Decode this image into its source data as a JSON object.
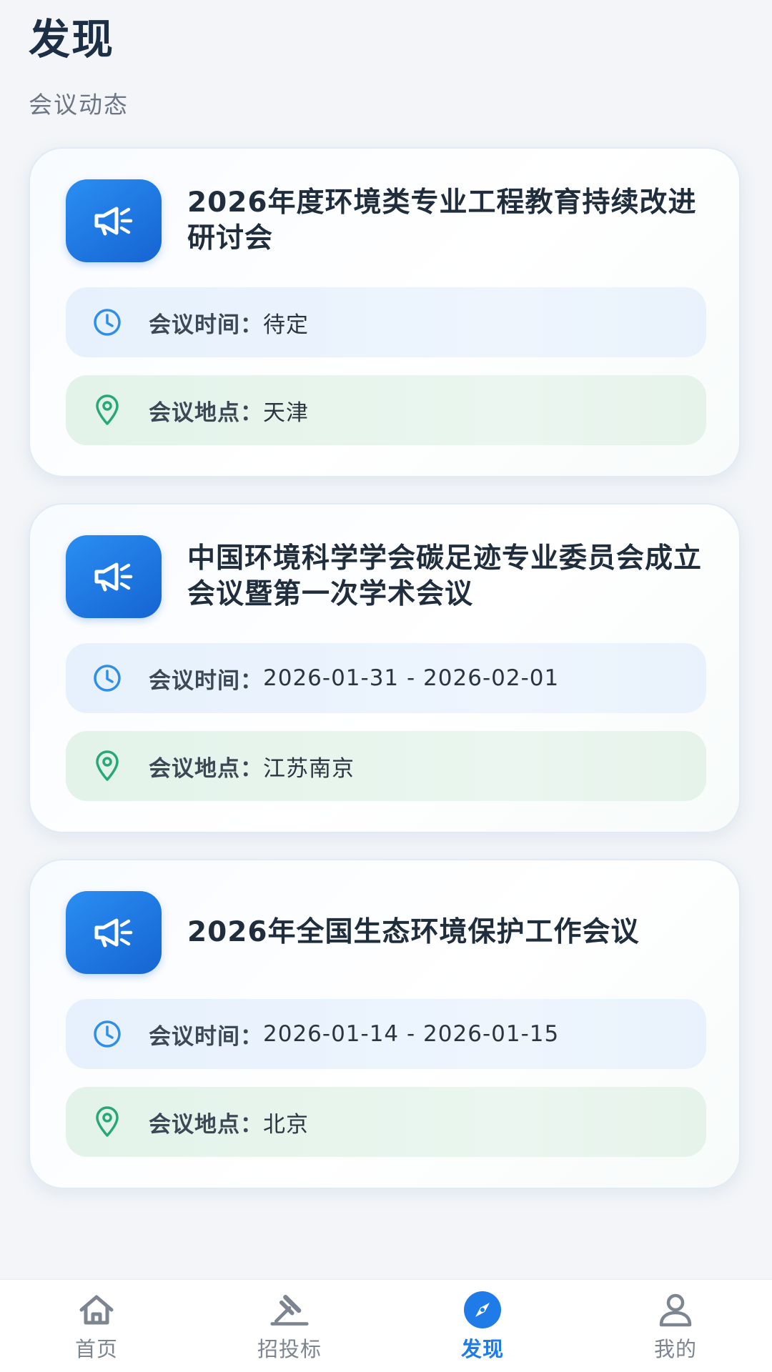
{
  "header": {
    "title": "发现",
    "subtitle": "会议动态"
  },
  "colors": {
    "accent": "#1f7be8",
    "time_row": "#e6f1fd",
    "place_row": "#e3f3ea"
  },
  "meetings": [
    {
      "icon": "megaphone-icon",
      "title": "2026年度环境类专业工程教育持续改进研讨会",
      "time_label": "会议时间：",
      "time_value": "待定",
      "place_label": "会议地点：",
      "place_value": "天津"
    },
    {
      "icon": "megaphone-icon",
      "title": "中国环境科学学会碳足迹专业委员会成立会议暨第一次学术会议",
      "time_label": "会议时间：",
      "time_value": "2026-01-31 - 2026-02-01",
      "place_label": "会议地点：",
      "place_value": "江苏南京"
    },
    {
      "icon": "megaphone-icon",
      "title": "2026年全国生态环境保护工作会议",
      "time_label": "会议时间：",
      "time_value": "2026-01-14 - 2026-01-15",
      "place_label": "会议地点：",
      "place_value": "北京"
    }
  ],
  "tabbar": {
    "items": [
      {
        "label": "首页",
        "icon": "home-icon",
        "active": false
      },
      {
        "label": "招投标",
        "icon": "gavel-icon",
        "active": false
      },
      {
        "label": "发现",
        "icon": "compass-icon",
        "active": true
      },
      {
        "label": "我的",
        "icon": "user-icon",
        "active": false
      }
    ]
  }
}
